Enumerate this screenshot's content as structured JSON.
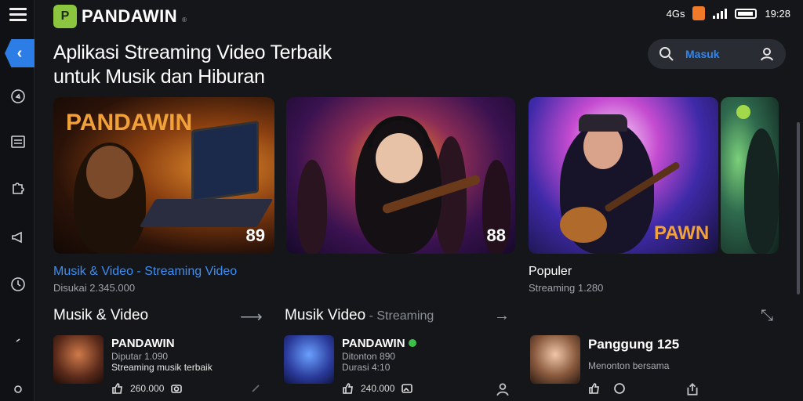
{
  "app": {
    "name": "PANDAWIN",
    "mark": "P",
    "tm": "®"
  },
  "status": {
    "network": "4Gs",
    "time": "19:28"
  },
  "headline": {
    "line1": "Aplikasi Streaming Video Terbaik",
    "line2": "untuk Musik dan Hiburan"
  },
  "search": {
    "label": "Masuk"
  },
  "hero": [
    {
      "art_text": "PANDAWIN",
      "badge": "89"
    },
    {
      "art_text": "",
      "badge": "88"
    },
    {
      "art_text": "PAWN",
      "badge": ""
    },
    {
      "art_text": "",
      "badge": ""
    }
  ],
  "captions": [
    {
      "title": "Musik & Video - Streaming Video",
      "sub": "Disukai 2.345.000"
    },
    {
      "title": "Populer",
      "sub": "Streaming 1.280"
    }
  ],
  "sections": [
    {
      "title": "Musik & Video",
      "muted": ""
    },
    {
      "title": "Musik Video",
      "muted": " - Streaming"
    }
  ],
  "items": [
    {
      "name": "PANDAWIN",
      "meta": "Diputar 1.090",
      "desc": "Streaming musik terbaik",
      "likes": "260.000"
    },
    {
      "name": "PANDAWIN",
      "meta": "Ditonton 890",
      "desc": "Durasi 4:10",
      "likes": "240.000"
    },
    {
      "name": "Panggung 125",
      "meta": "",
      "desc": "Menonton bersama",
      "likes": ""
    }
  ],
  "colors": {
    "accent": "#2f86f0",
    "brand": "#8cc63f",
    "bg": "#15161a"
  }
}
